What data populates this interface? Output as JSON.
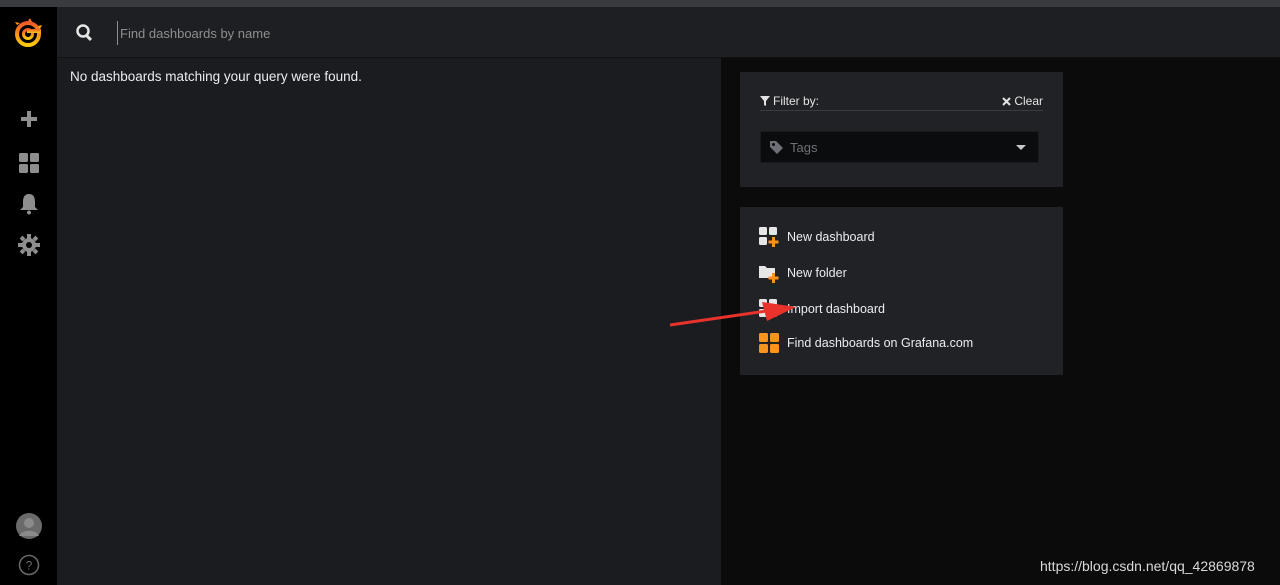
{
  "search": {
    "placeholder": "Find dashboards by name",
    "value": ""
  },
  "results": {
    "empty_message": "No dashboards matching your query were found."
  },
  "filter": {
    "label": "Filter by:",
    "clear_label": "Clear",
    "tags_placeholder": "Tags"
  },
  "actions": [
    {
      "label": "New dashboard",
      "icon": "new-dashboard-icon"
    },
    {
      "label": "New folder",
      "icon": "new-folder-icon"
    },
    {
      "label": "Import dashboard",
      "icon": "import-dashboard-icon"
    },
    {
      "label": "Find dashboards on Grafana.com",
      "icon": "grafana-dashboards-icon"
    }
  ],
  "sidebar": {
    "items": [
      "plus-icon",
      "dashboards-icon",
      "alerting-bell-icon",
      "configuration-gear-icon"
    ],
    "bottom": [
      "user-avatar",
      "help-icon"
    ]
  },
  "watermark": "https://blog.csdn.net/qq_42869878",
  "colors": {
    "accent_orange": "#f7941d",
    "sidebar_bg": "#000000",
    "panel_bg": "#212226",
    "arrow_red": "#e8322b"
  }
}
